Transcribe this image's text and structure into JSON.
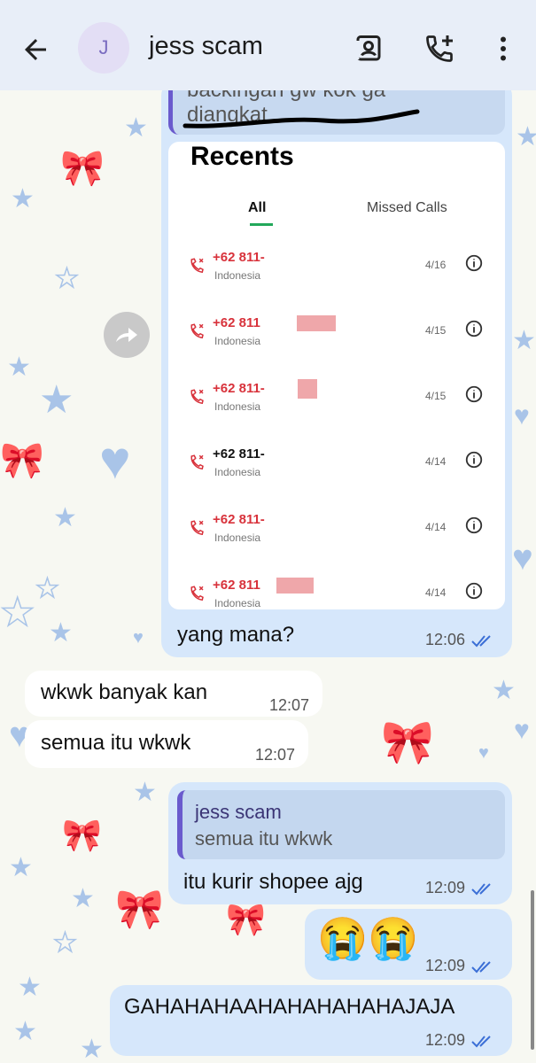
{
  "header": {
    "avatar_letter": "J",
    "title": "jess scam",
    "back_icon": "arrow-left-icon",
    "contact_card_icon": "contact-card-icon",
    "add_call_icon": "phone-add-icon",
    "more_icon": "more-vertical-icon"
  },
  "messages": {
    "quoted_top": {
      "line1": "backingan gw kok ga",
      "line2": "diangkat"
    },
    "screenshot": {
      "title": "Recents",
      "tab_all": "All",
      "tab_missed": "Missed Calls",
      "rows": [
        {
          "number": "+62 811-",
          "country": "Indonesia",
          "date": "4/16",
          "missed": true
        },
        {
          "number": "+62 811",
          "country": "Indonesia",
          "date": "4/15",
          "missed": true
        },
        {
          "number": "+62 811-",
          "country": "Indonesia",
          "date": "4/15",
          "missed": true
        },
        {
          "number": "+62 811-",
          "country": "Indonesia",
          "date": "4/14",
          "missed": false
        },
        {
          "number": "+62 811-",
          "country": "Indonesia",
          "date": "4/14",
          "missed": true
        },
        {
          "number": "+62 811",
          "country": "Indonesia",
          "date": "4/14",
          "missed": true
        }
      ]
    },
    "m1": {
      "text": "yang mana?",
      "time": "12:06"
    },
    "m2": {
      "text": "wkwk banyak kan",
      "time": "12:07"
    },
    "m3": {
      "text": "semua itu wkwk",
      "time": "12:07"
    },
    "m4": {
      "quote_name": "jess scam",
      "quote_text": "semua itu wkwk",
      "text": "itu kurir shopee ajg",
      "time": "12:09"
    },
    "m5": {
      "text": "😭😭",
      "time": "12:09"
    },
    "m6": {
      "text": "GAHAHAHAAHAHAHAHAHAJAJA",
      "time": "12:09"
    }
  },
  "colors": {
    "header_bg": "#e8eef8",
    "outgoing_bubble": "#d6e7fb",
    "incoming_bubble": "#ffffff",
    "missed_call_red": "#d8323b",
    "quote_bar": "#6a5acd",
    "read_ticks": "#3b6fd6"
  }
}
